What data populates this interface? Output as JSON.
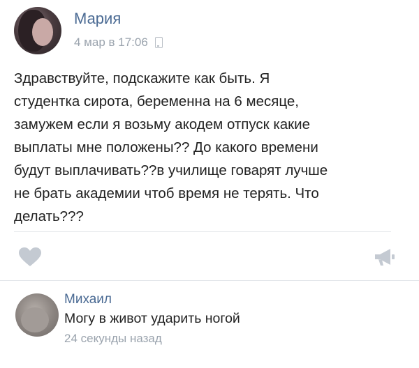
{
  "post": {
    "author": "Мария",
    "date": "4 мар в 17:06",
    "text": "Здравствуйте, подскажите как быть. Я\nстудентка сирота, беременна на 6 месяце,\nзамужем если я возьму акодем отпуск какие\nвыплаты мне положены?? До какого времени\nбудут выплачивать??в училище говарят лучше\nне брать академии чтоб время не терять. Что\nделать???"
  },
  "comment": {
    "author": "Михаил",
    "text": "Могу в живот ударить ногой",
    "time": "24 секунды назад"
  },
  "colors": {
    "name_link": "#4a6a93",
    "meta_gray": "#9aa3ad",
    "icon_gray": "#c4cad2"
  },
  "icons": {
    "device": "phone-icon",
    "like": "heart-icon",
    "share": "megaphone-icon"
  }
}
